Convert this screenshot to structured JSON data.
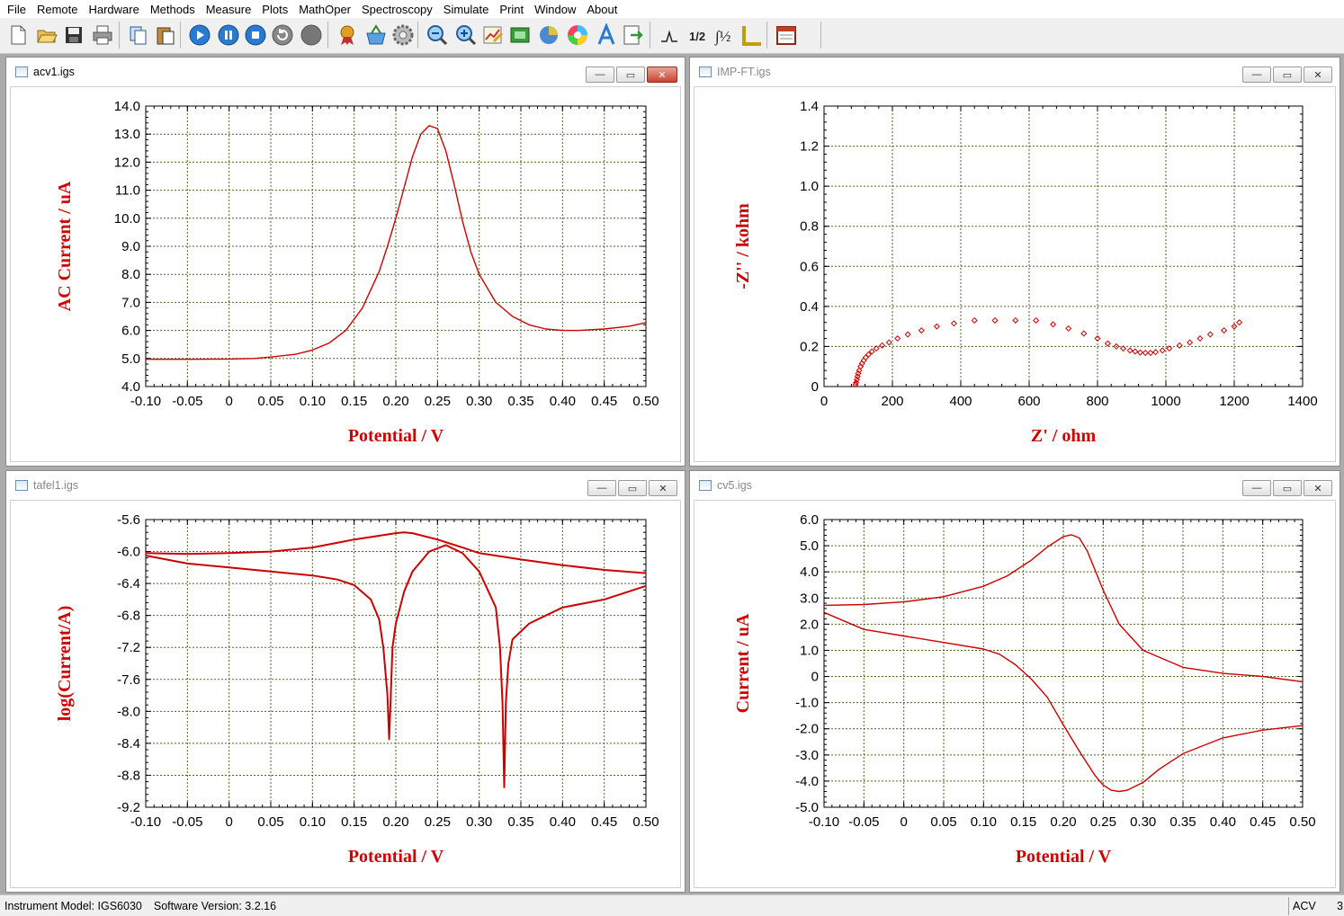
{
  "menu": [
    "File",
    "Remote",
    "Hardware",
    "Methods",
    "Measure",
    "Plots",
    "MathOper",
    "Spectroscopy",
    "Simulate",
    "Print",
    "Window",
    "About"
  ],
  "toolbar_icons": [
    "new-file-icon",
    "open-folder-icon",
    "save-icon",
    "print-icon",
    "copy-icon",
    "paste-icon",
    "run-icon",
    "pause-icon",
    "stop-icon",
    "repeat-icon",
    "gray-circle-icon",
    "badge-icon",
    "basket-icon",
    "settings-gear-icon",
    "zoom-out-icon",
    "zoom-in-icon",
    "edit-chart-icon",
    "green-board-icon",
    "pie-icon",
    "color-wheel-icon",
    "text-a-icon",
    "export-icon",
    "peak-icon",
    "half-fraction-icon",
    "integral-half-icon",
    "ruler-icon",
    "calendar-icon"
  ],
  "windows": {
    "acv": {
      "title": "acv1.igs"
    },
    "imp": {
      "title": "IMP-FT.igs"
    },
    "tafel": {
      "title": "tafel1.igs"
    },
    "cv": {
      "title": "cv5.igs"
    }
  },
  "window_buttons": {
    "minimize": "—",
    "restore": "▭",
    "close": "✕"
  },
  "colors": {
    "curve": "#cc0000",
    "axis_title": "#d00000",
    "grid": "#4a6a20"
  },
  "chart_data": [
    {
      "type": "line",
      "window": "acv1.igs",
      "xlabel": "Potential / V",
      "ylabel": "AC Current / uA",
      "xlim": [
        -0.1,
        0.5
      ],
      "ylim": [
        4.0,
        14.0
      ],
      "xticks": [
        "-0.10",
        "-0.05",
        "0",
        "0.05",
        "0.10",
        "0.15",
        "0.20",
        "0.25",
        "0.30",
        "0.35",
        "0.40",
        "0.45",
        "0.50"
      ],
      "yticks": [
        "14.0",
        "13.0",
        "12.0",
        "11.0",
        "10.0",
        "9.0",
        "8.0",
        "7.0",
        "6.0",
        "5.0",
        "4.0"
      ],
      "grid": true,
      "series": [
        {
          "x": [
            -0.1,
            -0.05,
            0.0,
            0.03,
            0.05,
            0.08,
            0.1,
            0.12,
            0.14,
            0.16,
            0.18,
            0.19,
            0.2,
            0.21,
            0.22,
            0.23,
            0.24,
            0.25,
            0.26,
            0.27,
            0.28,
            0.29,
            0.3,
            0.32,
            0.34,
            0.36,
            0.38,
            0.4,
            0.42,
            0.45,
            0.48,
            0.5
          ],
          "y": [
            4.97,
            4.97,
            4.98,
            5.0,
            5.05,
            5.15,
            5.3,
            5.55,
            6.0,
            6.8,
            8.1,
            9.0,
            10.0,
            11.1,
            12.2,
            13.0,
            13.3,
            13.2,
            12.4,
            11.2,
            9.9,
            8.8,
            8.0,
            7.0,
            6.5,
            6.2,
            6.05,
            6.0,
            6.0,
            6.05,
            6.15,
            6.28
          ]
        }
      ]
    },
    {
      "type": "scatter",
      "window": "IMP-FT.igs",
      "xlabel": "Z' / ohm",
      "ylabel": "-Z'' / kohm",
      "xlim": [
        0,
        1400
      ],
      "ylim": [
        0,
        1.4
      ],
      "xticks": [
        "0",
        "200",
        "400",
        "600",
        "800",
        "1000",
        "1200",
        "1400"
      ],
      "yticks": [
        "1.4",
        "1.2",
        "1.0",
        "0.8",
        "0.6",
        "0.4",
        "0.2",
        "0"
      ],
      "grid": true,
      "series": [
        {
          "x": [
            92,
            94,
            96,
            98,
            100,
            103,
            107,
            111,
            116,
            122,
            130,
            140,
            153,
            170,
            190,
            215,
            245,
            285,
            330,
            380,
            440,
            500,
            560,
            620,
            670,
            715,
            760,
            800,
            830,
            855,
            875,
            895,
            910,
            925,
            940,
            955,
            970,
            990,
            1010,
            1040,
            1070,
            1100,
            1130,
            1170,
            1200,
            1215
          ],
          "y": [
            0.01,
            0.02,
            0.035,
            0.05,
            0.065,
            0.08,
            0.1,
            0.115,
            0.13,
            0.145,
            0.16,
            0.175,
            0.19,
            0.205,
            0.22,
            0.24,
            0.26,
            0.28,
            0.3,
            0.315,
            0.33,
            0.33,
            0.33,
            0.33,
            0.31,
            0.29,
            0.265,
            0.24,
            0.215,
            0.2,
            0.19,
            0.18,
            0.175,
            0.17,
            0.168,
            0.168,
            0.172,
            0.18,
            0.19,
            0.205,
            0.22,
            0.24,
            0.26,
            0.28,
            0.3,
            0.32
          ]
        }
      ]
    },
    {
      "type": "line",
      "window": "tafel1.igs",
      "xlabel": "Potential / V",
      "ylabel": "log(Current/A)",
      "xlim": [
        -0.1,
        0.5
      ],
      "ylim": [
        -9.2,
        -5.6
      ],
      "xticks": [
        "-0.10",
        "-0.05",
        "0",
        "0.05",
        "0.10",
        "0.15",
        "0.20",
        "0.25",
        "0.30",
        "0.35",
        "0.40",
        "0.45",
        "0.50"
      ],
      "yticks": [
        "-5.6",
        "-6.0",
        "-6.4",
        "-6.8",
        "-7.2",
        "-7.6",
        "-8.0",
        "-8.4",
        "-8.8",
        "-9.2"
      ],
      "grid": true,
      "series": [
        {
          "x": [
            -0.1,
            -0.05,
            0.0,
            0.05,
            0.1,
            0.13,
            0.15,
            0.17,
            0.18,
            0.185,
            0.19,
            0.192,
            0.194,
            0.196,
            0.2,
            0.21,
            0.22,
            0.24,
            0.26,
            0.28,
            0.3,
            0.32,
            0.325,
            0.328,
            0.33,
            0.332,
            0.335,
            0.34,
            0.36,
            0.38,
            0.4,
            0.45,
            0.5
          ],
          "y": [
            -6.05,
            -6.15,
            -6.2,
            -6.25,
            -6.3,
            -6.35,
            -6.42,
            -6.6,
            -6.85,
            -7.2,
            -7.8,
            -8.35,
            -7.8,
            -7.2,
            -6.9,
            -6.5,
            -6.25,
            -6.0,
            -5.92,
            -6.02,
            -6.25,
            -6.7,
            -7.2,
            -7.9,
            -8.95,
            -7.9,
            -7.4,
            -7.1,
            -6.9,
            -6.8,
            -6.7,
            -6.6,
            -6.43
          ]
        },
        {
          "x": [
            -0.1,
            -0.05,
            0.0,
            0.05,
            0.1,
            0.15,
            0.2,
            0.21,
            0.22,
            0.25,
            0.28,
            0.3,
            0.35,
            0.4,
            0.45,
            0.5
          ],
          "y": [
            -6.02,
            -6.03,
            -6.02,
            -6.0,
            -5.95,
            -5.85,
            -5.77,
            -5.76,
            -5.77,
            -5.85,
            -5.95,
            -6.02,
            -6.1,
            -6.17,
            -6.23,
            -6.27
          ]
        }
      ]
    },
    {
      "type": "line",
      "window": "cv5.igs",
      "xlabel": "Potential / V",
      "ylabel": "Current / uA",
      "xlim": [
        -0.1,
        0.5
      ],
      "ylim": [
        -5.0,
        6.0
      ],
      "xticks": [
        "-0.10",
        "-0.05",
        "0",
        "0.05",
        "0.10",
        "0.15",
        "0.20",
        "0.25",
        "0.30",
        "0.35",
        "0.40",
        "0.45",
        "0.50"
      ],
      "yticks": [
        "6.0",
        "5.0",
        "4.0",
        "3.0",
        "2.0",
        "1.0",
        "0",
        "-1.0",
        "-2.0",
        "-3.0",
        "-4.0",
        "-5.0"
      ],
      "grid": true,
      "series": [
        {
          "name": "",
          "x": [
            -0.1,
            -0.05,
            0.0,
            0.05,
            0.1,
            0.13,
            0.16,
            0.18,
            0.2,
            0.21,
            0.22,
            0.23,
            0.25,
            0.27,
            0.3,
            0.35,
            0.4,
            0.45,
            0.5
          ],
          "y": [
            2.72,
            2.75,
            2.85,
            3.05,
            3.45,
            3.85,
            4.45,
            4.95,
            5.35,
            5.42,
            5.3,
            4.8,
            3.3,
            2.0,
            1.0,
            0.35,
            0.12,
            0.0,
            -0.2
          ]
        },
        {
          "name": "",
          "x": [
            0.5,
            0.45,
            0.4,
            0.35,
            0.32,
            0.3,
            0.28,
            0.27,
            0.26,
            0.25,
            0.24,
            0.22,
            0.2,
            0.18,
            0.16,
            0.14,
            0.12,
            0.1,
            0.05,
            0.0,
            -0.05,
            -0.1
          ],
          "y": [
            -1.88,
            -2.05,
            -2.35,
            -2.95,
            -3.55,
            -4.05,
            -4.35,
            -4.4,
            -4.35,
            -4.15,
            -3.8,
            -2.85,
            -1.85,
            -0.8,
            -0.1,
            0.45,
            0.85,
            1.05,
            1.3,
            1.55,
            1.8,
            2.45
          ]
        }
      ]
    }
  ],
  "status": {
    "model": "Instrument Model: IGS6030",
    "version": "Software Version: 3.2.16",
    "mode": "ACV",
    "extra": "3"
  }
}
